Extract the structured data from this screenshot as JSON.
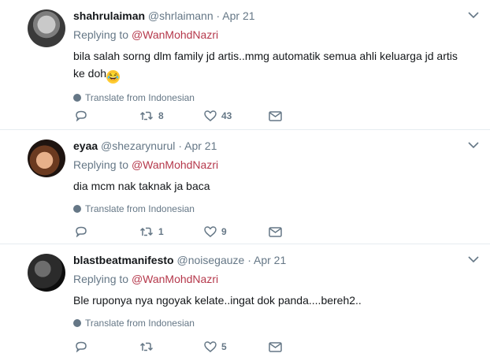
{
  "tweets": [
    {
      "name": "shahrulaiman",
      "handle": "@shrlaimann",
      "dot": "·",
      "time": "Apr 21",
      "replying_prefix": "Replying to",
      "replying_to": "@WanMohdNazri",
      "text_line1": "bila salah sorng dlm family jd artis..mmg automatik semua ahli keluarga jd artis",
      "text_line2": "ke doh",
      "emoji": "😂",
      "translate": "Translate from Indonesian",
      "reply_count": "",
      "retweet_count": "8",
      "like_count": "43"
    },
    {
      "name": "eyaa",
      "handle": "@shezarynurul",
      "dot": "·",
      "time": "Apr 21",
      "replying_prefix": "Replying to",
      "replying_to": "@WanMohdNazri",
      "text_line1": "dia mcm nak taknak ja baca",
      "translate": "Translate from Indonesian",
      "reply_count": "",
      "retweet_count": "1",
      "like_count": "9"
    },
    {
      "name": "blastbeatmanifesto",
      "handle": "@noisegauze",
      "dot": "·",
      "time": "Apr 21",
      "replying_prefix": "Replying to",
      "replying_to": "@WanMohdNazri",
      "text_line1": "Ble ruponya nya ngoyak kelate..ingat dok panda....bereh2..",
      "translate": "Translate from Indonesian",
      "reply_count": "",
      "retweet_count": "",
      "like_count": "5"
    }
  ],
  "icons": {
    "reply": "reply-icon",
    "retweet": "retweet-icon",
    "like": "heart-icon",
    "dm": "envelope-icon",
    "more": "chevron-down-icon",
    "translate": "globe-icon"
  },
  "colors": {
    "mention": "#b5384b",
    "secondary_text": "#657786",
    "divider": "#e6ecf0"
  }
}
